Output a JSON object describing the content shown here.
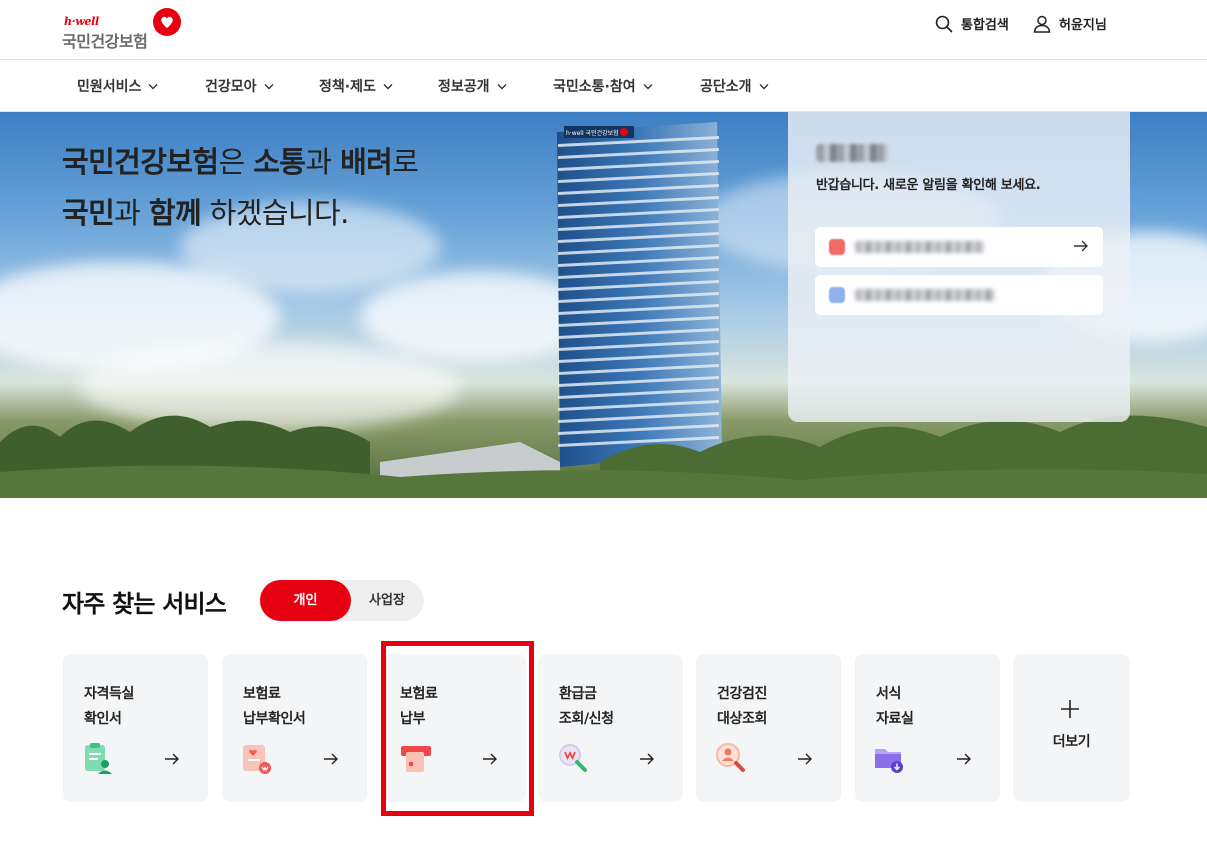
{
  "header": {
    "logo_hwell": "h·well",
    "logo_text": "국민건강보험",
    "search_label": "통합검색",
    "user_label": "허윤지님"
  },
  "gnb": [
    {
      "label": "민원서비스"
    },
    {
      "label": "건강모아"
    },
    {
      "label": "정책·제도"
    },
    {
      "label": "정보공개"
    },
    {
      "label": "국민소통·참여"
    },
    {
      "label": "공단소개"
    }
  ],
  "hero": {
    "line1": [
      {
        "text": "국민건강보험",
        "bold": true
      },
      {
        "text": "은 ",
        "bold": false
      },
      {
        "text": "소통",
        "bold": true
      },
      {
        "text": "과 ",
        "bold": false
      },
      {
        "text": "배려",
        "bold": true
      },
      {
        "text": "로",
        "bold": false
      }
    ],
    "line2": [
      {
        "text": "국민",
        "bold": true
      },
      {
        "text": "과 ",
        "bold": false
      },
      {
        "text": "함께",
        "bold": true
      },
      {
        "text": " 하겠습니다.",
        "bold": false
      }
    ],
    "building_sign": "h·well 국민건강보험"
  },
  "notice": {
    "greeting": "반갑습니다. 새로운 알림을 확인해 보세요."
  },
  "services": {
    "title": "자주 찾는 서비스",
    "toggle_personal": "개인",
    "toggle_business": "사업장",
    "cards": [
      {
        "line1": "자격득실",
        "line2": "확인서",
        "icon": "id-card-person-icon",
        "color": "#3cc38a"
      },
      {
        "line1": "보험료",
        "line2": "납부확인서",
        "icon": "certificate-icon",
        "color": "#f07a7a"
      },
      {
        "line1": "보험료",
        "line2": "납부",
        "icon": "card-payment-icon",
        "color": "#f04848"
      },
      {
        "line1": "환급금",
        "line2": "조회/신청",
        "icon": "magnifier-won-icon",
        "color": "#3cc38a"
      },
      {
        "line1": "건강검진",
        "line2": "대상조회",
        "icon": "person-search-icon",
        "color": "#f07a5a"
      },
      {
        "line1": "서식",
        "line2": "자료실",
        "icon": "folder-download-icon",
        "color": "#8a6de9"
      }
    ],
    "more_label": "더보기"
  },
  "colors": {
    "brand": "#e60012",
    "card_bg": "#f4f5f7"
  }
}
